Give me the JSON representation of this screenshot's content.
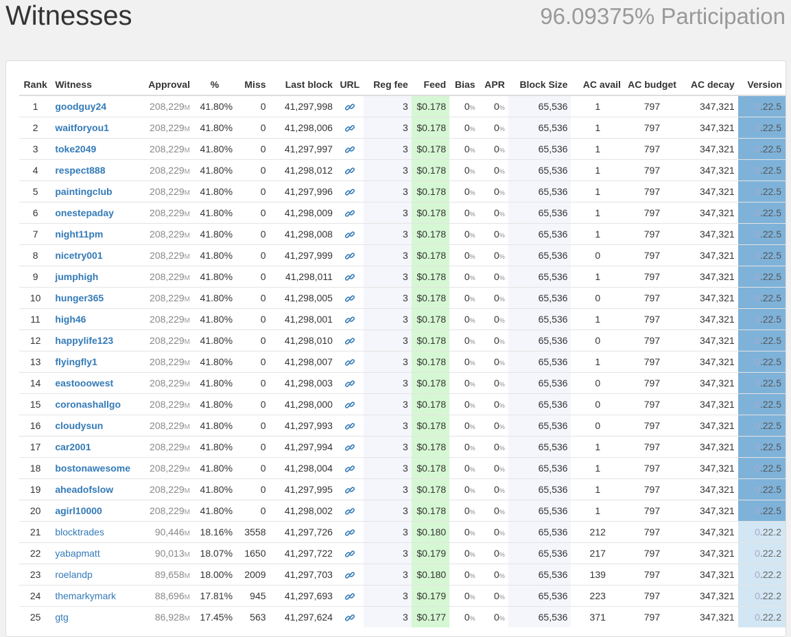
{
  "header": {
    "title": "Witnesses",
    "participation": "96.09375% Participation"
  },
  "columns": [
    "Rank",
    "Witness",
    "Approval",
    "%",
    "Miss",
    "Last block",
    "URL",
    "Reg fee",
    "Feed",
    "Bias",
    "APR",
    "Block Size",
    "AC avail",
    "AC budget",
    "AC decay",
    "Version"
  ],
  "approval_unit": "M",
  "percent_unit": "%",
  "rows": [
    {
      "rank": "1",
      "name": "goodguy24",
      "approval": "208,229",
      "pct": "41.80%",
      "miss": "0",
      "last_block": "41,297,998",
      "reg_fee": "3",
      "feed": "$0.178",
      "bias": "0",
      "apr": "0",
      "block_size": "65,536",
      "ac_avail": "1",
      "ac_budget": "797",
      "ac_decay": "347,321",
      "version_lead": "0",
      "version_rest": ".22.5",
      "top": true
    },
    {
      "rank": "2",
      "name": "waitforyou1",
      "approval": "208,229",
      "pct": "41.80%",
      "miss": "0",
      "last_block": "41,298,006",
      "reg_fee": "3",
      "feed": "$0.178",
      "bias": "0",
      "apr": "0",
      "block_size": "65,536",
      "ac_avail": "1",
      "ac_budget": "797",
      "ac_decay": "347,321",
      "version_lead": "0",
      "version_rest": ".22.5",
      "top": true
    },
    {
      "rank": "3",
      "name": "toke2049",
      "approval": "208,229",
      "pct": "41.80%",
      "miss": "0",
      "last_block": "41,297,997",
      "reg_fee": "3",
      "feed": "$0.178",
      "bias": "0",
      "apr": "0",
      "block_size": "65,536",
      "ac_avail": "1",
      "ac_budget": "797",
      "ac_decay": "347,321",
      "version_lead": "0",
      "version_rest": ".22.5",
      "top": true
    },
    {
      "rank": "4",
      "name": "respect888",
      "approval": "208,229",
      "pct": "41.80%",
      "miss": "0",
      "last_block": "41,298,012",
      "reg_fee": "3",
      "feed": "$0.178",
      "bias": "0",
      "apr": "0",
      "block_size": "65,536",
      "ac_avail": "1",
      "ac_budget": "797",
      "ac_decay": "347,321",
      "version_lead": "0",
      "version_rest": ".22.5",
      "top": true
    },
    {
      "rank": "5",
      "name": "paintingclub",
      "approval": "208,229",
      "pct": "41.80%",
      "miss": "0",
      "last_block": "41,297,996",
      "reg_fee": "3",
      "feed": "$0.178",
      "bias": "0",
      "apr": "0",
      "block_size": "65,536",
      "ac_avail": "1",
      "ac_budget": "797",
      "ac_decay": "347,321",
      "version_lead": "0",
      "version_rest": ".22.5",
      "top": true
    },
    {
      "rank": "6",
      "name": "onestepaday",
      "approval": "208,229",
      "pct": "41.80%",
      "miss": "0",
      "last_block": "41,298,009",
      "reg_fee": "3",
      "feed": "$0.178",
      "bias": "0",
      "apr": "0",
      "block_size": "65,536",
      "ac_avail": "1",
      "ac_budget": "797",
      "ac_decay": "347,321",
      "version_lead": "0",
      "version_rest": ".22.5",
      "top": true
    },
    {
      "rank": "7",
      "name": "night11pm",
      "approval": "208,229",
      "pct": "41.80%",
      "miss": "0",
      "last_block": "41,298,008",
      "reg_fee": "3",
      "feed": "$0.178",
      "bias": "0",
      "apr": "0",
      "block_size": "65,536",
      "ac_avail": "1",
      "ac_budget": "797",
      "ac_decay": "347,321",
      "version_lead": "0",
      "version_rest": ".22.5",
      "top": true
    },
    {
      "rank": "8",
      "name": "nicetry001",
      "approval": "208,229",
      "pct": "41.80%",
      "miss": "0",
      "last_block": "41,297,999",
      "reg_fee": "3",
      "feed": "$0.178",
      "bias": "0",
      "apr": "0",
      "block_size": "65,536",
      "ac_avail": "0",
      "ac_budget": "797",
      "ac_decay": "347,321",
      "version_lead": "0",
      "version_rest": ".22.5",
      "top": true
    },
    {
      "rank": "9",
      "name": "jumphigh",
      "approval": "208,229",
      "pct": "41.80%",
      "miss": "0",
      "last_block": "41,298,011",
      "reg_fee": "3",
      "feed": "$0.178",
      "bias": "0",
      "apr": "0",
      "block_size": "65,536",
      "ac_avail": "1",
      "ac_budget": "797",
      "ac_decay": "347,321",
      "version_lead": "0",
      "version_rest": ".22.5",
      "top": true
    },
    {
      "rank": "10",
      "name": "hunger365",
      "approval": "208,229",
      "pct": "41.80%",
      "miss": "0",
      "last_block": "41,298,005",
      "reg_fee": "3",
      "feed": "$0.178",
      "bias": "0",
      "apr": "0",
      "block_size": "65,536",
      "ac_avail": "0",
      "ac_budget": "797",
      "ac_decay": "347,321",
      "version_lead": "0",
      "version_rest": ".22.5",
      "top": true
    },
    {
      "rank": "11",
      "name": "high46",
      "approval": "208,229",
      "pct": "41.80%",
      "miss": "0",
      "last_block": "41,298,001",
      "reg_fee": "3",
      "feed": "$0.178",
      "bias": "0",
      "apr": "0",
      "block_size": "65,536",
      "ac_avail": "1",
      "ac_budget": "797",
      "ac_decay": "347,321",
      "version_lead": "0",
      "version_rest": ".22.5",
      "top": true
    },
    {
      "rank": "12",
      "name": "happylife123",
      "approval": "208,229",
      "pct": "41.80%",
      "miss": "0",
      "last_block": "41,298,010",
      "reg_fee": "3",
      "feed": "$0.178",
      "bias": "0",
      "apr": "0",
      "block_size": "65,536",
      "ac_avail": "0",
      "ac_budget": "797",
      "ac_decay": "347,321",
      "version_lead": "0",
      "version_rest": ".22.5",
      "top": true
    },
    {
      "rank": "13",
      "name": "flyingfly1",
      "approval": "208,229",
      "pct": "41.80%",
      "miss": "0",
      "last_block": "41,298,007",
      "reg_fee": "3",
      "feed": "$0.178",
      "bias": "0",
      "apr": "0",
      "block_size": "65,536",
      "ac_avail": "1",
      "ac_budget": "797",
      "ac_decay": "347,321",
      "version_lead": "0",
      "version_rest": ".22.5",
      "top": true
    },
    {
      "rank": "14",
      "name": "eastooowest",
      "approval": "208,229",
      "pct": "41.80%",
      "miss": "0",
      "last_block": "41,298,003",
      "reg_fee": "3",
      "feed": "$0.178",
      "bias": "0",
      "apr": "0",
      "block_size": "65,536",
      "ac_avail": "0",
      "ac_budget": "797",
      "ac_decay": "347,321",
      "version_lead": "0",
      "version_rest": ".22.5",
      "top": true
    },
    {
      "rank": "15",
      "name": "coronashallgo",
      "approval": "208,229",
      "pct": "41.80%",
      "miss": "0",
      "last_block": "41,298,000",
      "reg_fee": "3",
      "feed": "$0.178",
      "bias": "0",
      "apr": "0",
      "block_size": "65,536",
      "ac_avail": "0",
      "ac_budget": "797",
      "ac_decay": "347,321",
      "version_lead": "0",
      "version_rest": ".22.5",
      "top": true
    },
    {
      "rank": "16",
      "name": "cloudysun",
      "approval": "208,229",
      "pct": "41.80%",
      "miss": "0",
      "last_block": "41,297,993",
      "reg_fee": "3",
      "feed": "$0.178",
      "bias": "0",
      "apr": "0",
      "block_size": "65,536",
      "ac_avail": "0",
      "ac_budget": "797",
      "ac_decay": "347,321",
      "version_lead": "0",
      "version_rest": ".22.5",
      "top": true
    },
    {
      "rank": "17",
      "name": "car2001",
      "approval": "208,229",
      "pct": "41.80%",
      "miss": "0",
      "last_block": "41,297,994",
      "reg_fee": "3",
      "feed": "$0.178",
      "bias": "0",
      "apr": "0",
      "block_size": "65,536",
      "ac_avail": "1",
      "ac_budget": "797",
      "ac_decay": "347,321",
      "version_lead": "0",
      "version_rest": ".22.5",
      "top": true
    },
    {
      "rank": "18",
      "name": "bostonawesome",
      "approval": "208,229",
      "pct": "41.80%",
      "miss": "0",
      "last_block": "41,298,004",
      "reg_fee": "3",
      "feed": "$0.178",
      "bias": "0",
      "apr": "0",
      "block_size": "65,536",
      "ac_avail": "1",
      "ac_budget": "797",
      "ac_decay": "347,321",
      "version_lead": "0",
      "version_rest": ".22.5",
      "top": true
    },
    {
      "rank": "19",
      "name": "aheadofslow",
      "approval": "208,229",
      "pct": "41.80%",
      "miss": "0",
      "last_block": "41,297,995",
      "reg_fee": "3",
      "feed": "$0.178",
      "bias": "0",
      "apr": "0",
      "block_size": "65,536",
      "ac_avail": "1",
      "ac_budget": "797",
      "ac_decay": "347,321",
      "version_lead": "0",
      "version_rest": ".22.5",
      "top": true
    },
    {
      "rank": "20",
      "name": "agirl10000",
      "approval": "208,229",
      "pct": "41.80%",
      "miss": "0",
      "last_block": "41,298,002",
      "reg_fee": "3",
      "feed": "$0.178",
      "bias": "0",
      "apr": "0",
      "block_size": "65,536",
      "ac_avail": "1",
      "ac_budget": "797",
      "ac_decay": "347,321",
      "version_lead": "0",
      "version_rest": ".22.5",
      "top": true
    },
    {
      "rank": "21",
      "name": "blocktrades",
      "approval": "90,446",
      "pct": "18.16%",
      "miss": "3558",
      "last_block": "41,297,726",
      "reg_fee": "3",
      "feed": "$0.180",
      "bias": "0",
      "apr": "0",
      "block_size": "65,536",
      "ac_avail": "212",
      "ac_budget": "797",
      "ac_decay": "347,321",
      "version_lead": "0",
      "version_rest": ".22.2",
      "top": false
    },
    {
      "rank": "22",
      "name": "yabapmatt",
      "approval": "90,013",
      "pct": "18.07%",
      "miss": "1650",
      "last_block": "41,297,722",
      "reg_fee": "3",
      "feed": "$0.179",
      "bias": "0",
      "apr": "0",
      "block_size": "65,536",
      "ac_avail": "217",
      "ac_budget": "797",
      "ac_decay": "347,321",
      "version_lead": "0",
      "version_rest": ".22.2",
      "top": false
    },
    {
      "rank": "23",
      "name": "roelandp",
      "approval": "89,658",
      "pct": "18.00%",
      "miss": "2009",
      "last_block": "41,297,703",
      "reg_fee": "3",
      "feed": "$0.180",
      "bias": "0",
      "apr": "0",
      "block_size": "65,536",
      "ac_avail": "139",
      "ac_budget": "797",
      "ac_decay": "347,321",
      "version_lead": "0",
      "version_rest": ".22.2",
      "top": false
    },
    {
      "rank": "24",
      "name": "themarkymark",
      "approval": "88,696",
      "pct": "17.81%",
      "miss": "945",
      "last_block": "41,297,693",
      "reg_fee": "3",
      "feed": "$0.179",
      "bias": "0",
      "apr": "0",
      "block_size": "65,536",
      "ac_avail": "223",
      "ac_budget": "797",
      "ac_decay": "347,321",
      "version_lead": "0",
      "version_rest": ".22.2",
      "top": false
    },
    {
      "rank": "25",
      "name": "gtg",
      "approval": "86,928",
      "pct": "17.45%",
      "miss": "563",
      "last_block": "41,297,624",
      "reg_fee": "3",
      "feed": "$0.177",
      "bias": "0",
      "apr": "0",
      "block_size": "65,536",
      "ac_avail": "371",
      "ac_budget": "797",
      "ac_decay": "347,321",
      "version_lead": "0",
      "version_rest": ".22.2",
      "top": false
    }
  ],
  "colors": {
    "link": "#337ab7",
    "feed_bg": "#d6f7d3",
    "version_top_bg": "#7fb2d9",
    "version_backup_bg": "#d3e6f3"
  },
  "icons": {
    "url": "link-icon"
  }
}
